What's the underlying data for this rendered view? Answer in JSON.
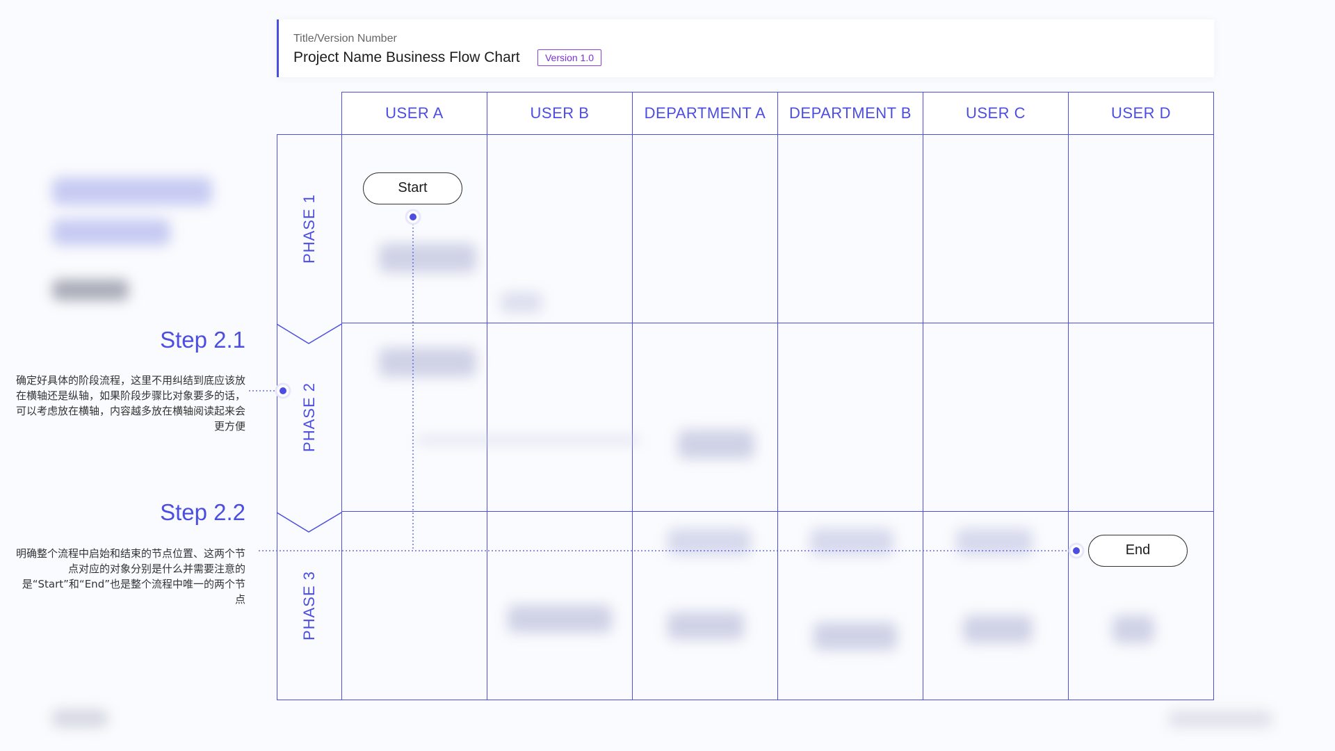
{
  "header": {
    "label": "Title/Version Number",
    "title": "Project Name Business Flow Chart",
    "version": "Version 1.0"
  },
  "lanes": [
    "USER A",
    "USER B",
    "DEPARTMENT A",
    "DEPARTMENT B",
    "USER C",
    "USER D"
  ],
  "phases": [
    "PHASE 1",
    "PHASE 2",
    "PHASE 3"
  ],
  "nodes": {
    "start": "Start",
    "end": "End"
  },
  "notes": [
    {
      "title": "Step 2.1",
      "text": "确定好具体的阶段流程，这里不用纠结到底应该放在横轴还是纵轴，如果阶段步骤比对象要多的话，可以考虑放在横轴，内容越多放在横轴阅读起来会更方便"
    },
    {
      "title": "Step 2.2",
      "text": "明确整个流程中启始和结束的节点位置、这两个节点对应的对象分别是什么并需要注意的是“Start”和“End”也是整个流程中唯一的两个节点"
    }
  ],
  "colors": {
    "accent": "#4c4ee0",
    "badge": "#7a30d6",
    "background": "#fafbfe"
  }
}
